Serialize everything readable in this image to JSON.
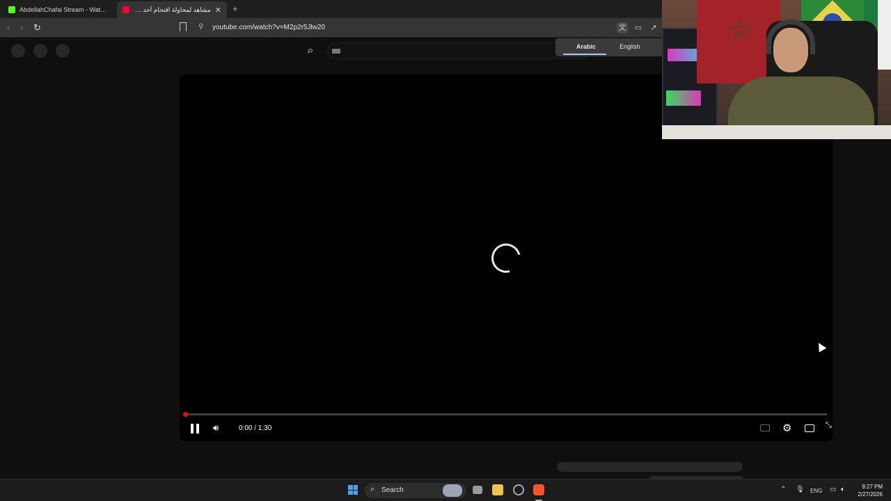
{
  "browser": {
    "tabs": [
      {
        "title": "AbdellahChafai Stream - Watch Live",
        "favicon_color": "#53fc18"
      },
      {
        "title": "مشاهد لمحاولة اقتحام أحد مراكز الـ",
        "favicon_color": "#ff0033"
      }
    ],
    "url": "youtube.com/watch?v=M2p2r5Jlw20"
  },
  "translate_popup": {
    "from_language": "Arabic",
    "to_language": "English"
  },
  "player": {
    "state": "loading",
    "time_display": "0:00 / 1:30",
    "progress": 0.0,
    "accent_color": "#ff0000"
  },
  "taskbar": {
    "search_label": "Search",
    "language": "ENG",
    "time": "9:27 PM",
    "date": "2/27/2026"
  },
  "icons": [
    "back-icon",
    "forward-icon",
    "reload-icon",
    "bookmark-icon",
    "translate-icon",
    "cast-icon",
    "share-icon",
    "search-icon",
    "pause-icon",
    "volume-icon",
    "subtitles-icon",
    "settings-icon",
    "theater-icon",
    "fullscreen-icon"
  ]
}
